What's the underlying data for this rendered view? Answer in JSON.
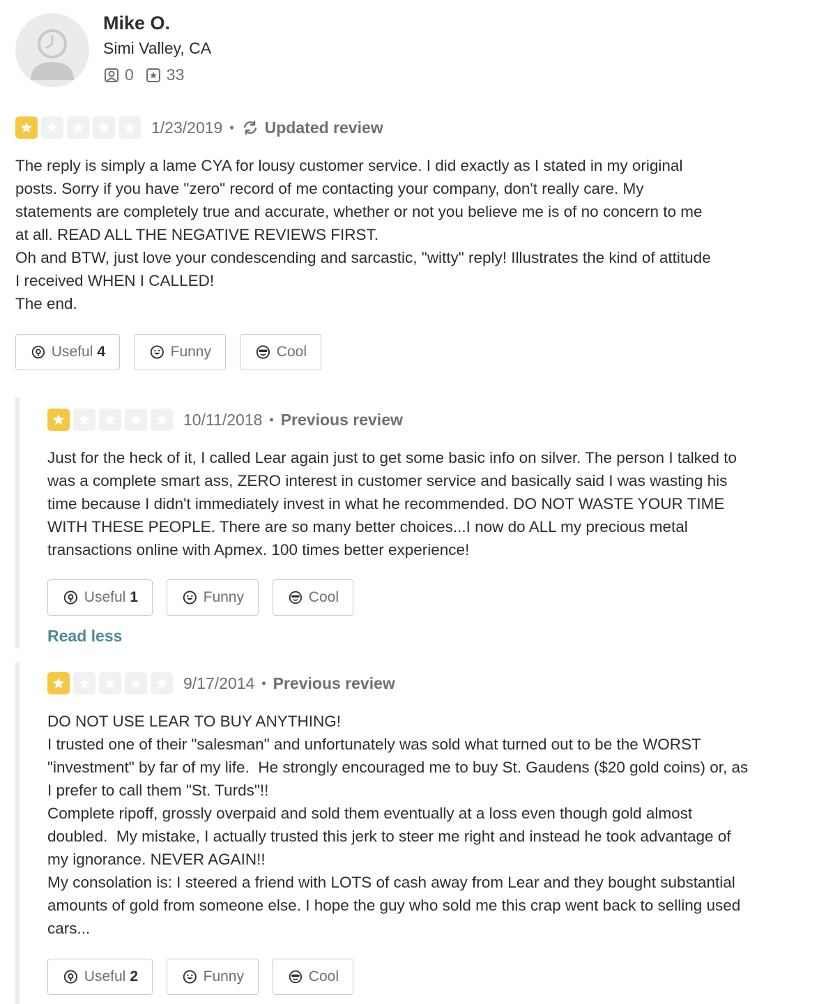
{
  "user": {
    "name": "Mike O.",
    "location": "Simi Valley, CA",
    "friends": "0",
    "reviews": "33"
  },
  "current_review": {
    "stars": 1,
    "date": "1/23/2019",
    "status": "Updated review",
    "text": "The reply is simply a lame CYA for lousy customer service. I did exactly as I stated in my original\nposts. Sorry if you have \"zero\" record of me contacting your company, don't really care. My\nstatements are completely true and accurate, whether or not you believe me is of no concern to me\nat all. READ ALL THE NEGATIVE REVIEWS FIRST.\nOh and BTW, just love your condescending and sarcastic, \"witty\" reply! Illustrates the kind of attitude\nI received WHEN I CALLED!\nThe end.",
    "useful_label": "Useful",
    "useful_count": "4",
    "funny_label": "Funny",
    "cool_label": "Cool"
  },
  "previous_reviews": [
    {
      "stars": 1,
      "date": "10/11/2018",
      "status": "Previous review",
      "text": "Just for the heck of it, I called Lear again just to get some basic info on silver. The person I talked to\nwas a complete smart ass, ZERO interest in customer service and basically said I was wasting his\ntime because I didn't immediately invest in what he recommended. DO NOT WASTE YOUR TIME\nWITH THESE PEOPLE. There are so many better choices...I now do ALL my precious metal\ntransactions online with Apmex. 100 times better experience!",
      "useful_label": "Useful",
      "useful_count": "1",
      "funny_label": "Funny",
      "cool_label": "Cool",
      "read_less": "Read less"
    },
    {
      "stars": 1,
      "date": "9/17/2014",
      "status": "Previous review",
      "text": "DO NOT USE LEAR TO BUY ANYTHING!\nI trusted one of their \"salesman\" and unfortunately was sold what turned out to be the WORST\n\"investment\" by far of my life.  He strongly encouraged me to buy St. Gaudens ($20 gold coins) or, as\nI prefer to call them \"St. Turds\"!!\nComplete ripoff, grossly overpaid and sold them eventually at a loss even though gold almost\ndoubled.  My mistake, I actually trusted this jerk to steer me right and instead he took advantage of\nmy ignorance. NEVER AGAIN!!\nMy consolation is: I steered a friend with LOTS of cash away from Lear and they bought substantial\namounts of gold from someone else. I hope the guy who sold me this crap went back to selling used\ncars...",
      "useful_label": "Useful",
      "useful_count": "2",
      "funny_label": "Funny",
      "cool_label": "Cool"
    }
  ],
  "colors": {
    "star_on": "#f5c843",
    "star_off": "#f1f1f1",
    "link": "#4d8a96"
  }
}
